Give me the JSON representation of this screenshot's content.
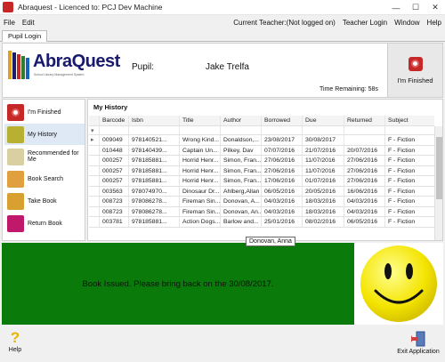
{
  "window": {
    "title": "Abraquest - Licenced to: PCJ Dev Machine"
  },
  "menu": {
    "left": [
      "File",
      "Edit"
    ],
    "current_teacher": "Current Teacher:(Not logged on)",
    "right": [
      "Teacher Login",
      "Window",
      "Help"
    ]
  },
  "tab": {
    "label": "Pupil Login"
  },
  "header": {
    "logo_name": "AbraQuest",
    "logo_tagline": "School Library Management System",
    "pupil_label": "Pupil:",
    "pupil_name": "Jake Trelfa",
    "time_remaining": "Time Remaining: 58s",
    "finished_label": "I'm Finished"
  },
  "sidebar": {
    "items": [
      {
        "label": "I'm Finished",
        "icon": "finished-icon",
        "color": "#c62828"
      },
      {
        "label": "My History",
        "icon": "history-icon",
        "color": "#b8b030"
      },
      {
        "label": "Recommended for Me",
        "icon": "recommended-icon",
        "color": "#d8d0a0"
      },
      {
        "label": "Book Search",
        "icon": "book-search-icon",
        "color": "#e0a040"
      },
      {
        "label": "Take Book",
        "icon": "take-book-icon",
        "color": "#d8a030"
      },
      {
        "label": "Return Book",
        "icon": "return-book-icon",
        "color": "#c0186a"
      }
    ]
  },
  "history": {
    "title": "My History",
    "columns": [
      "Barcode",
      "Isbn",
      "Title",
      "Author",
      "Borrowed",
      "Due",
      "Returned",
      "Subject"
    ],
    "rows": [
      [
        "009049",
        "978140521...",
        "Wrong Kind...",
        "Donaldson,...",
        "23/08/2017",
        "30/08/2017",
        "",
        "F - Fiction"
      ],
      [
        "010448",
        "978140439...",
        "Captain Un...",
        "Pilkey, Dav",
        "07/07/2016",
        "21/07/2016",
        "20/07/2016",
        "F - Fiction"
      ],
      [
        "000257",
        "978185881...",
        "Horrid Henr...",
        "Simon, Fran...",
        "27/06/2016",
        "11/07/2016",
        "27/06/2016",
        "F - Fiction"
      ],
      [
        "000257",
        "978185881...",
        "Horrid Henr...",
        "Simon, Fran...",
        "27/06/2016",
        "11/07/2016",
        "27/06/2016",
        "F - Fiction"
      ],
      [
        "000257",
        "978185881...",
        "Horrid Henr...",
        "Simon, Fran...",
        "17/06/2016",
        "01/07/2016",
        "27/06/2016",
        "F - Fiction"
      ],
      [
        "003563",
        "978074970...",
        "Dinosaur Dr...",
        "Ahlberg,Allan",
        "06/05/2016",
        "20/05/2016",
        "16/06/2016",
        "F - Fiction"
      ],
      [
        "008723",
        "978086278...",
        "Fireman Sin...",
        "Donovan, A...",
        "04/03/2016",
        "18/03/2016",
        "04/03/2016",
        "F - Fiction"
      ],
      [
        "008723",
        "978086278...",
        "Fireman Sin...",
        "Donovan, An...",
        "04/03/2016",
        "18/03/2016",
        "04/03/2016",
        "F - Fiction"
      ],
      [
        "003781",
        "978185881...",
        "Action Dogs...",
        "Barlow and...",
        "25/01/2016",
        "08/02/2016",
        "06/05/2016",
        "F - Fiction"
      ]
    ],
    "tooltip": "Donovan, Anna",
    "filter_icon": "filter-icon"
  },
  "notice": {
    "message": "Book Issued. Please bring back on the 30/08/2017.",
    "color": "#0a7a0a"
  },
  "footer": {
    "help_label": "Help",
    "exit_label": "Exit Application"
  }
}
